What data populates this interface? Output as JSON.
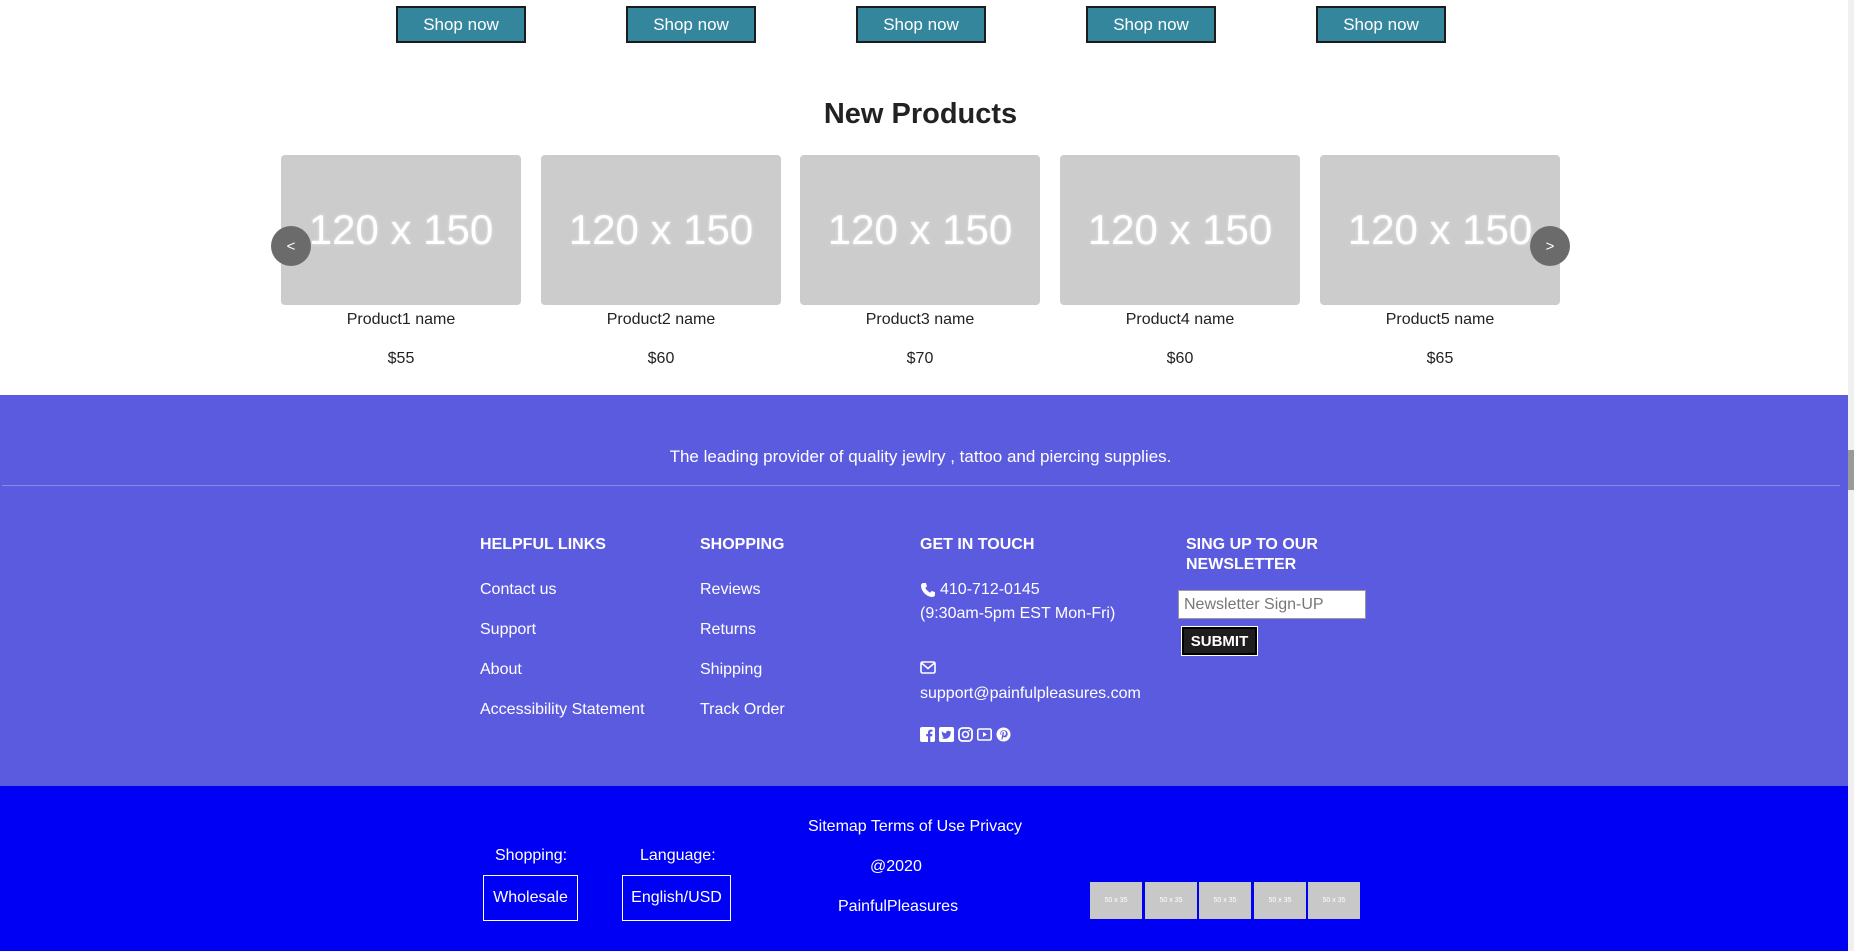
{
  "shop_buttons": [
    "Shop now",
    "Shop now",
    "Shop now",
    "Shop now",
    "Shop now"
  ],
  "new_products": {
    "title": "New Products",
    "prev_label": "<",
    "next_label": ">",
    "items": [
      {
        "image": "120 x 150",
        "name": "Product1 name",
        "price": "$55"
      },
      {
        "image": "120 x 150",
        "name": "Product2 name",
        "price": "$60"
      },
      {
        "image": "120 x 150",
        "name": "Product3 name",
        "price": "$70"
      },
      {
        "image": "120 x 150",
        "name": "Product4 name",
        "price": "$60"
      },
      {
        "image": "120 x 150",
        "name": "Product5 name",
        "price": "$65"
      }
    ]
  },
  "footer": {
    "tagline": "The leading provider of quality jewlry , tattoo and piercing supplies.",
    "helpful_links": {
      "heading": "HELPFUL LINKS",
      "links": [
        "Contact us",
        "Support",
        "About",
        "Accessibility Statement"
      ]
    },
    "shopping": {
      "heading": "SHOPPING",
      "links": [
        "Reviews",
        "Returns",
        "Shipping",
        "Track Order"
      ]
    },
    "get_in_touch": {
      "heading": "GET IN TOUCH",
      "phone": "410-712-0145",
      "hours": "(9:30am-5pm EST Mon-Fri)",
      "email": "support@painfulpleasures.com",
      "social_icons": [
        "facebook-icon",
        "twitter-icon",
        "instagram-icon",
        "youtube-icon",
        "pinterest-icon"
      ]
    },
    "newsletter": {
      "heading_line1": "SING UP TO OUR",
      "heading_line2": "NEWSLETTER",
      "placeholder": "Newsletter Sign-UP",
      "submit_label": "SUBMIT"
    }
  },
  "bottom_bar": {
    "shopping_label": "Shopping:",
    "language_label": "Language:",
    "wholesale_label": "Wholesale",
    "language_value": "English/USD",
    "links_text": "Sitemap Terms of Use Privacy",
    "copyright_year": "@2020",
    "company": "PainfulPleasures",
    "payment_icons": [
      "50 x 35",
      "50 x 35",
      "50 x 35",
      "50 x 35",
      "50 x 35"
    ]
  },
  "colors": {
    "shop_button": "#34869c",
    "footer_purple": "#5b5be0",
    "footer_blue": "#0000f5",
    "placeholder_gray": "#cccccc"
  }
}
